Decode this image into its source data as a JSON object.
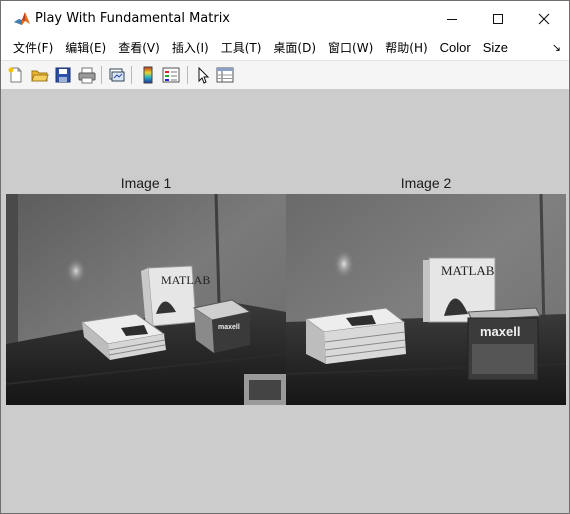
{
  "window": {
    "title": "Play With Fundamental Matrix",
    "minimize_icon": "minimize-icon",
    "maximize_icon": "maximize-icon",
    "close_icon": "close-icon"
  },
  "menubar": {
    "items": [
      "文件(F)",
      "编辑(E)",
      "查看(V)",
      "插入(I)",
      "工具(T)",
      "桌面(D)",
      "窗口(W)",
      "帮助(H)",
      "Color",
      "Size"
    ],
    "overflow_glyph": "↘"
  },
  "toolbar": {
    "icons": [
      "new-figure-icon",
      "open-file-icon",
      "save-icon",
      "print-icon",
      "link-plot-icon",
      "insert-colorbar-icon",
      "insert-legend-icon",
      "edit-plot-icon",
      "property-inspector-icon"
    ]
  },
  "figure": {
    "axes": [
      {
        "title": "Image 1"
      },
      {
        "title": "Image 2"
      }
    ],
    "maxell_label": "maxell",
    "matlab_label": "MATLAB"
  }
}
